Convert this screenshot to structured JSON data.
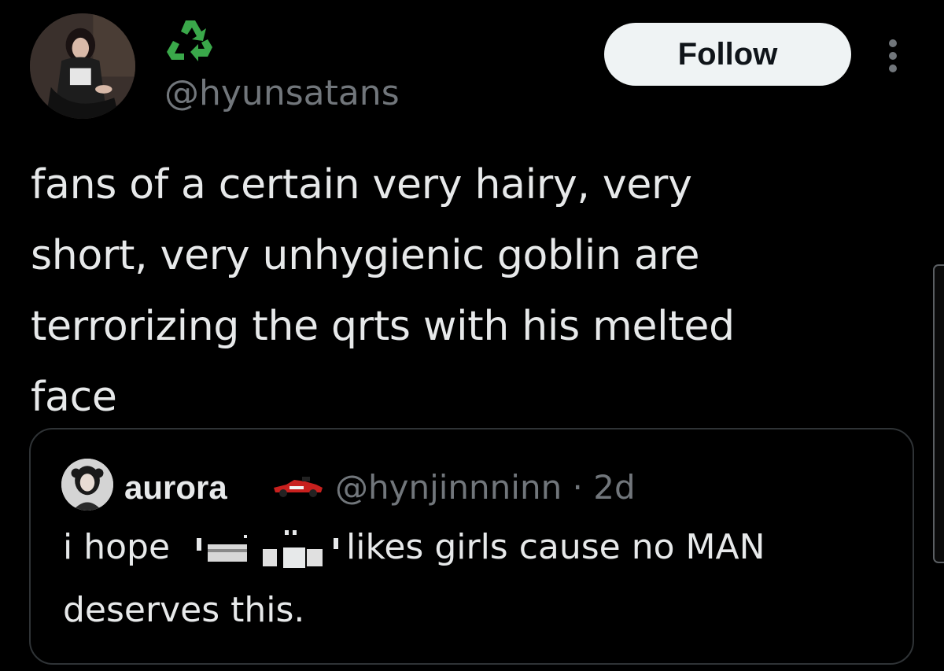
{
  "tweet": {
    "handle": "@hyunsatans",
    "display_name_icon": "recycle-icon",
    "follow_label": "Follow",
    "more_icon": "more-vertical-icon",
    "text": "fans of a certain very hairy, very\nshort, very unhygienic goblin are\nterrorizing the qrts with his melted\nface"
  },
  "quote": {
    "name": "aurora",
    "name_icon": "race-car-icon",
    "meta": "@hynjinnninn · 2d",
    "text_before": "i hope",
    "text_after": "likes girls cause no MAN",
    "text_line2": "deserves this."
  },
  "colors": {
    "background": "#000000",
    "text_primary": "#e7e9ea",
    "text_secondary": "#71767b",
    "follow_bg": "#eff3f4",
    "border": "#2f3336"
  }
}
